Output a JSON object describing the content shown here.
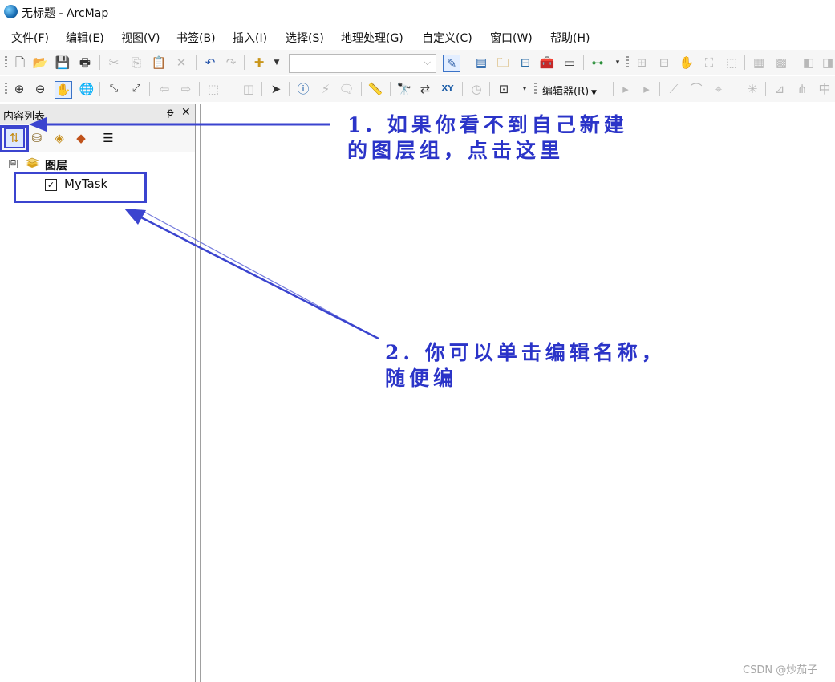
{
  "window": {
    "title": "无标题 - ArcMap"
  },
  "menu": [
    "文件(F)",
    "编辑(E)",
    "视图(V)",
    "书签(B)",
    "插入(I)",
    "选择(S)",
    "地理处理(G)",
    "自定义(C)",
    "窗口(W)",
    "帮助(H)"
  ],
  "toolbar": {
    "editor_label": "编辑器(R)",
    "add_data_combo_value": ""
  },
  "toc": {
    "title": "内容列表",
    "pin_glyph": "ᵽ",
    "close_glyph": "✕",
    "root": {
      "label": "图层",
      "expander": "⊟"
    },
    "layers": [
      {
        "label": "MyTask",
        "checked": true
      }
    ]
  },
  "annotations": {
    "note1": "1. 如果你看不到自己新建\n的图层组，点击这里",
    "note2": "2. 你可以单击编辑名称，\n随便编",
    "color": "#3b44cf"
  },
  "watermark": "CSDN @炒茄子"
}
